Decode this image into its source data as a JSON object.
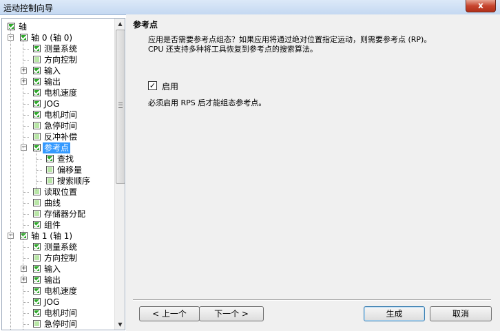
{
  "window": {
    "title": "运动控制向导",
    "close_glyph": "x"
  },
  "tree": {
    "nodes": [
      {
        "label": "轴",
        "checked": true,
        "level": 0,
        "expander": null
      },
      {
        "label": "轴 0 (轴 0)",
        "checked": true,
        "level": 1,
        "expander": "-"
      },
      {
        "label": "测量系统",
        "checked": true,
        "level": 2,
        "expander": null
      },
      {
        "label": "方向控制",
        "checked": false,
        "level": 2,
        "expander": null
      },
      {
        "label": "输入",
        "checked": true,
        "level": 2,
        "expander": "+"
      },
      {
        "label": "输出",
        "checked": true,
        "level": 2,
        "expander": "+"
      },
      {
        "label": "电机速度",
        "checked": true,
        "level": 2,
        "expander": null
      },
      {
        "label": "JOG",
        "checked": true,
        "level": 2,
        "expander": null
      },
      {
        "label": "电机时间",
        "checked": true,
        "level": 2,
        "expander": null
      },
      {
        "label": "急停时间",
        "checked": false,
        "level": 2,
        "expander": null
      },
      {
        "label": "反冲补偿",
        "checked": false,
        "level": 2,
        "expander": null
      },
      {
        "label": "参考点",
        "checked": true,
        "level": 2,
        "expander": "-",
        "selected": true
      },
      {
        "label": "查找",
        "checked": true,
        "level": 3,
        "expander": null
      },
      {
        "label": "偏移量",
        "checked": false,
        "level": 3,
        "expander": null
      },
      {
        "label": "搜索顺序",
        "checked": false,
        "level": 3,
        "expander": null
      },
      {
        "label": "读取位置",
        "checked": false,
        "level": 2,
        "expander": null
      },
      {
        "label": "曲线",
        "checked": false,
        "level": 2,
        "expander": null
      },
      {
        "label": "存储器分配",
        "checked": false,
        "level": 2,
        "expander": null
      },
      {
        "label": "组件",
        "checked": true,
        "level": 2,
        "expander": null
      },
      {
        "label": "轴 1 (轴 1)",
        "checked": true,
        "level": 1,
        "expander": "-"
      },
      {
        "label": "测量系统",
        "checked": true,
        "level": 2,
        "expander": null
      },
      {
        "label": "方向控制",
        "checked": false,
        "level": 2,
        "expander": null
      },
      {
        "label": "输入",
        "checked": true,
        "level": 2,
        "expander": "+"
      },
      {
        "label": "输出",
        "checked": true,
        "level": 2,
        "expander": "+"
      },
      {
        "label": "电机速度",
        "checked": true,
        "level": 2,
        "expander": null
      },
      {
        "label": "JOG",
        "checked": true,
        "level": 2,
        "expander": null
      },
      {
        "label": "电机时间",
        "checked": true,
        "level": 2,
        "expander": null
      },
      {
        "label": "急停时间",
        "checked": false,
        "level": 2,
        "expander": null
      }
    ]
  },
  "page": {
    "heading": "参考点",
    "desc_line1": "应用是否需要参考点组态？如果应用将通过绝对位置指定运动，则需要参考点 (RP)。",
    "desc_line2": "CPU 还支持多种将工具恢复到参考点的搜索算法。",
    "enable_label": "启用",
    "enable_checked": true,
    "note": "必须启用 RPS 后才能组态参考点。"
  },
  "buttons": {
    "prev": "< 上一个",
    "next": "下一个 >",
    "generate": "生成",
    "cancel": "取消"
  },
  "colors": {
    "selection": "#3399ff",
    "check_green": "#2ea82a",
    "panel_bg": "#f0f0f0"
  }
}
